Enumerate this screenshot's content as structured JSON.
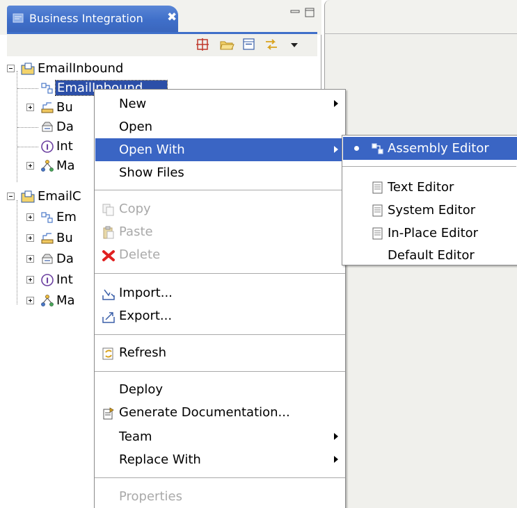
{
  "view": {
    "title": "Business Integration",
    "close_glyph": "✖"
  },
  "toolbar": {
    "icons": [
      "grid-icon",
      "open-folder-icon",
      "collapse-all-icon",
      "link-editor-icon",
      "view-menu-icon"
    ]
  },
  "tree": {
    "items": [
      {
        "label": "EmailInbound",
        "icon": "module-icon",
        "level": 0,
        "toggle": "minus"
      },
      {
        "label": "EmailInbound",
        "icon": "assembly-icon",
        "level": 1,
        "selected": true
      },
      {
        "label": "Bu",
        "icon": "business-logic-icon",
        "level": 1,
        "toggle": "plus"
      },
      {
        "label": "Da",
        "icon": "data-types-icon",
        "level": 1
      },
      {
        "label": "Int",
        "icon": "interfaces-icon",
        "level": 1
      },
      {
        "label": "Ma",
        "icon": "maps-icon",
        "level": 1,
        "toggle": "plus"
      },
      {
        "label": "EmailC",
        "icon": "module-icon",
        "level": 0,
        "toggle": "minus"
      },
      {
        "label": "Em",
        "icon": "assembly-icon",
        "level": 1,
        "toggle": "plus"
      },
      {
        "label": "Bu",
        "icon": "business-logic-icon",
        "level": 1,
        "toggle": "plus"
      },
      {
        "label": "Da",
        "icon": "data-types-icon",
        "level": 1,
        "toggle": "plus"
      },
      {
        "label": "Int",
        "icon": "interfaces-icon",
        "level": 1,
        "toggle": "plus"
      },
      {
        "label": "Ma",
        "icon": "maps-icon",
        "level": 1,
        "toggle": "plus"
      }
    ]
  },
  "context_menu": {
    "new": "New",
    "open": "Open",
    "open_with": "Open With",
    "show_files": "Show Files",
    "copy": "Copy",
    "paste": "Paste",
    "delete": "Delete",
    "import": "Import...",
    "export": "Export...",
    "refresh": "Refresh",
    "deploy": "Deploy",
    "generate_documentation": "Generate Documentation...",
    "team": "Team",
    "replace_with": "Replace With",
    "properties": "Properties"
  },
  "submenu": {
    "assembly_editor": "Assembly Editor",
    "text_editor": "Text Editor",
    "system_editor": "System Editor",
    "in_place_editor": "In-Place Editor",
    "default_editor": "Default Editor"
  },
  "colors": {
    "tab_active": "#3f6fc9",
    "menu_highlight": "#3a65c4",
    "disabled_text": "#a9a9a9"
  }
}
